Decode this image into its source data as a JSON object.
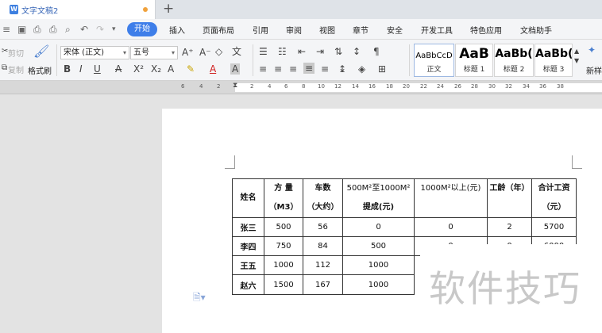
{
  "window": {
    "doc_title": "文字文稿2",
    "new_tab_symbol": "+"
  },
  "menu": {
    "active": "开始",
    "items": [
      "插入",
      "页面布局",
      "引用",
      "审阅",
      "视图",
      "章节",
      "安全",
      "开发工具",
      "特色应用",
      "文档助手"
    ]
  },
  "ribbon": {
    "cut": "剪切",
    "copy": "复制",
    "format_painter": "格式刷",
    "font_name": "宋体 (正文)",
    "font_size": "五号",
    "styles": [
      {
        "sample": "AaBbCcD",
        "name": "正文"
      },
      {
        "sample": "AaB",
        "name": "标题 1"
      },
      {
        "sample": "AaBb(",
        "name": "标题 2"
      },
      {
        "sample": "AaBb(",
        "name": "标题 3"
      }
    ],
    "new_style": "新样"
  },
  "ruler": {
    "left_numbers": [
      "6",
      "4",
      "2"
    ],
    "right_numbers": [
      "2",
      "4",
      "6",
      "8",
      "10",
      "12",
      "14",
      "16",
      "18",
      "20",
      "22",
      "24",
      "26",
      "28",
      "30",
      "32",
      "34",
      "36",
      "38"
    ]
  },
  "table": {
    "headers": [
      [
        "姓名"
      ],
      [
        "方 量",
        "（M3）"
      ],
      [
        "车数",
        "（大约）"
      ],
      [
        "500M²至1000M²",
        "提成(元)"
      ],
      [
        "1000M²以上(元)"
      ],
      [
        "工龄（年）"
      ],
      [
        "合计工资",
        "（元）"
      ]
    ],
    "rows": [
      [
        "张三",
        "500",
        "56",
        "0",
        "0",
        "2",
        "5700"
      ],
      [
        "李四",
        "750",
        "84",
        "500",
        "0",
        "0",
        "6000"
      ],
      [
        "王五",
        "1000",
        "112",
        "1000"
      ],
      [
        "赵六",
        "1500",
        "167",
        "1000"
      ]
    ]
  },
  "watermark": "软件技巧",
  "colors": {
    "accent": "#3e7ee9",
    "tab_dot": "#f0a23c"
  }
}
